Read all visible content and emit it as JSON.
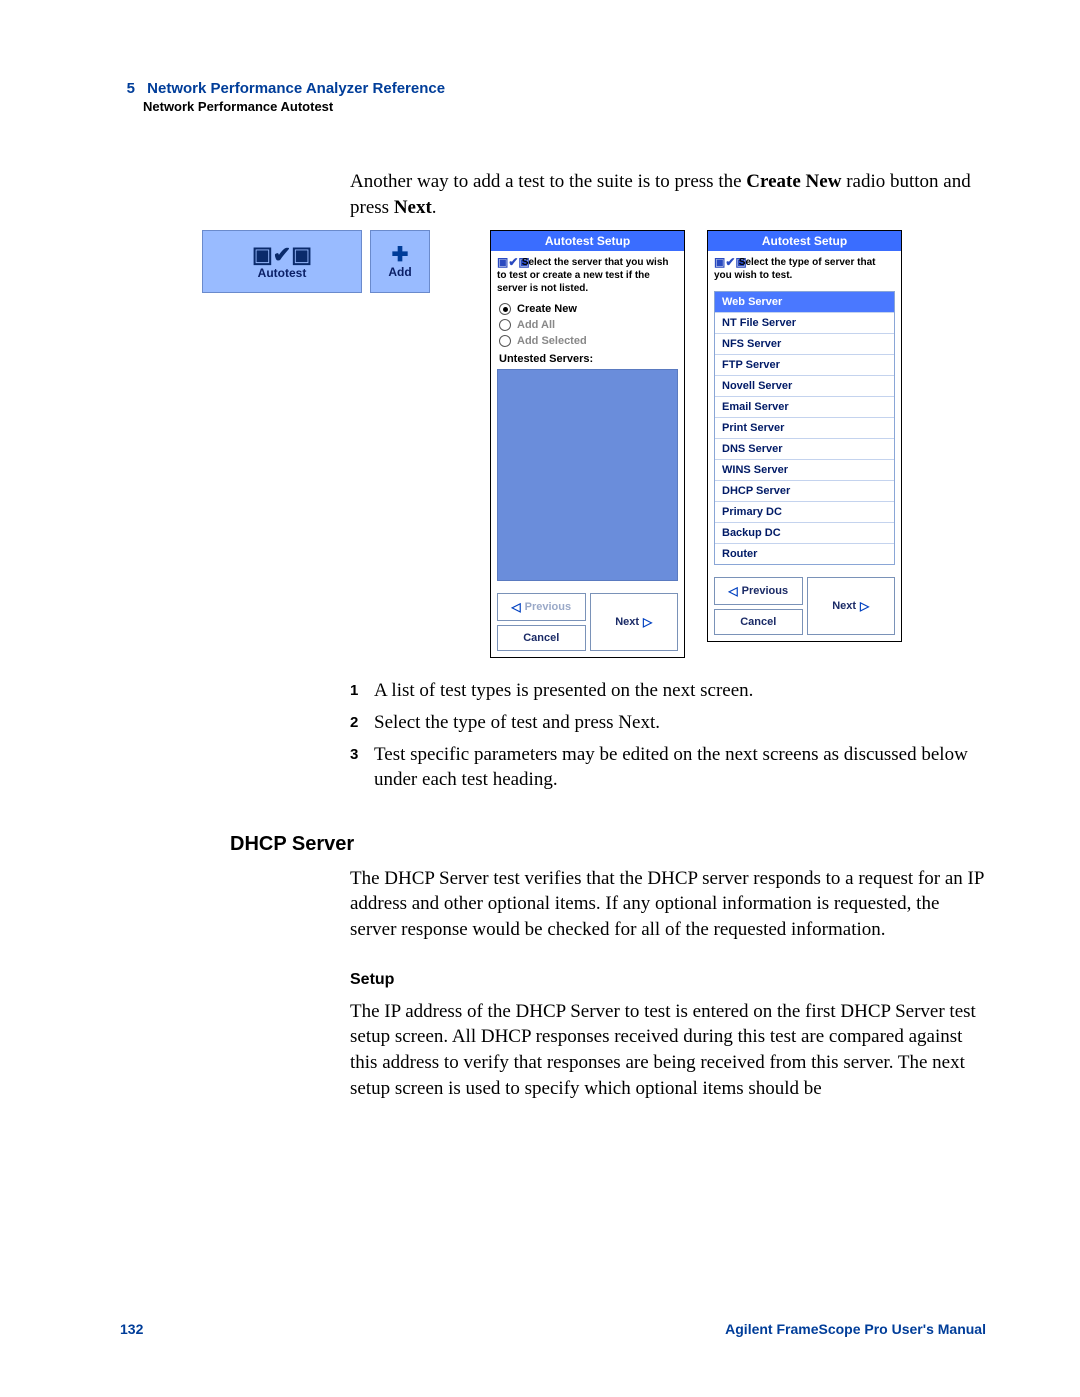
{
  "header": {
    "chapter_num": "5",
    "chapter_title": "Network Performance Analyzer Reference",
    "section": "Network Performance Autotest"
  },
  "intro": {
    "pre": "Another way to add a test to the suite is to press the ",
    "b1": "Create New",
    "mid": " radio button and press ",
    "b2": "Next",
    "post": "."
  },
  "icons": {
    "autotest_label": "Autotest",
    "add_label": "Add"
  },
  "dlg1": {
    "title": "Autotest Setup",
    "instr": "Select the server that you wish to test or create a new test if the server is not listed.",
    "r1": "Create New",
    "r2": "Add All",
    "r3": "Add Selected",
    "untested": "Untested Servers:",
    "prev": "Previous",
    "next": "Next",
    "cancel": "Cancel"
  },
  "dlg2": {
    "title": "Autotest Setup",
    "instr": "Select the type of server that you wish to test.",
    "items": {
      "i0": "Web Server",
      "i1": "NT File Server",
      "i2": "NFS Server",
      "i3": "FTP Server",
      "i4": "Novell Server",
      "i5": "Email Server",
      "i6": "Print Server",
      "i7": "DNS Server",
      "i8": "WINS Server",
      "i9": "DHCP Server",
      "i10": "Primary DC",
      "i11": "Backup DC",
      "i12": "Router"
    },
    "prev": "Previous",
    "next": "Next",
    "cancel": "Cancel"
  },
  "steps": {
    "n1": "1",
    "t1": "A list of test types is presented on the next screen.",
    "n2": "2",
    "t2": "Select the type of test and press Next.",
    "n3": "3",
    "t3": "Test specific parameters may be edited on the next screens as discussed below under each test heading."
  },
  "dhcp": {
    "heading": "DHCP Server",
    "para": "The DHCP Server test verifies that the DHCP server responds to a request for an IP address and other optional items. If any optional information is requested, the server response would be checked for all of the requested information."
  },
  "setup": {
    "heading": "Setup",
    "para": "The IP address of the DHCP Server to test is entered on the first DHCP Server test setup screen. All DHCP responses received during this test are compared against this address to verify that responses are being received from this server. The next setup screen is used to specify which optional items should be"
  },
  "footer": {
    "page": "132",
    "manual": "Agilent FrameScope Pro User's Manual"
  }
}
